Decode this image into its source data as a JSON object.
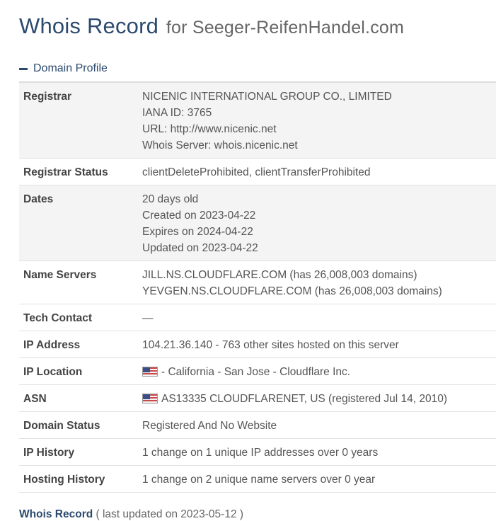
{
  "header": {
    "title": "Whois Record",
    "for_text": "for Seeger-ReifenHandel.com"
  },
  "section": {
    "label": "Domain Profile",
    "toggle_icon": "minus-icon"
  },
  "rows": {
    "registrar": {
      "label": "Registrar",
      "lines": [
        "NICENIC INTERNATIONAL GROUP CO., LIMITED",
        "IANA ID: 3765",
        "URL: http://www.nicenic.net",
        "Whois Server: whois.nicenic.net"
      ]
    },
    "registrar_status": {
      "label": "Registrar Status",
      "value": "clientDeleteProhibited, clientTransferProhibited"
    },
    "dates": {
      "label": "Dates",
      "lines": [
        "20 days old",
        "Created on 2023-04-22",
        "Expires on 2024-04-22",
        "Updated on 2023-04-22"
      ]
    },
    "name_servers": {
      "label": "Name Servers",
      "lines": [
        "JILL.NS.CLOUDFLARE.COM (has 26,008,003 domains)",
        "YEVGEN.NS.CLOUDFLARE.COM (has 26,008,003 domains)"
      ]
    },
    "tech_contact": {
      "label": "Tech Contact",
      "value": "—"
    },
    "ip_address": {
      "label": "IP Address",
      "value": "104.21.36.140 - 763 other sites hosted on this server"
    },
    "ip_location": {
      "label": "IP Location",
      "value": "- California - San Jose - Cloudflare Inc.",
      "icon": "us-flag-icon"
    },
    "asn": {
      "label": "ASN",
      "value": "AS13335 CLOUDFLARENET, US (registered Jul 14, 2010)",
      "icon": "us-flag-icon"
    },
    "domain_status": {
      "label": "Domain Status",
      "value": "Registered And No Website"
    },
    "ip_history": {
      "label": "IP History",
      "value": "1 change on 1 unique IP addresses over 0 years"
    },
    "hosting_history": {
      "label": "Hosting History",
      "value": "1 change on 2 unique name servers over 0 year"
    }
  },
  "footer": {
    "title": "Whois Record",
    "meta": "( last updated on 2023-05-12 )"
  },
  "colors": {
    "heading": "#2c4a6e",
    "row_shade": "#f4f4f4"
  }
}
